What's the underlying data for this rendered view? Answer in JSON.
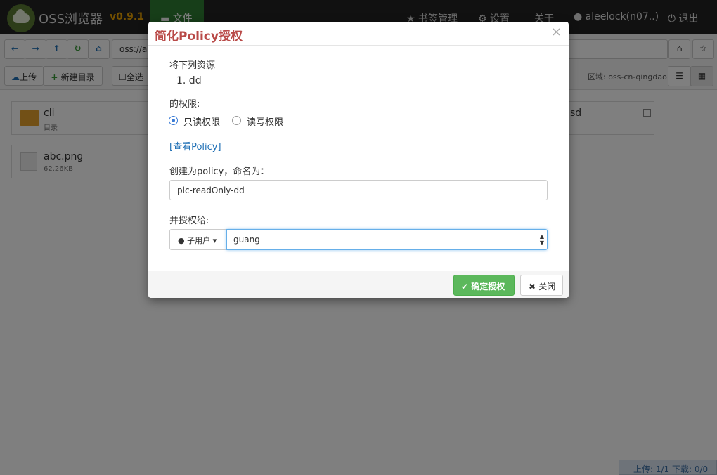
{
  "app": {
    "title": "OSS浏览器",
    "version": "v0.9.1"
  },
  "nav": {
    "file": "文件",
    "bookmarks": "书签管理",
    "settings": "设置",
    "about": "关于",
    "user": "aleelock(n07..)",
    "logout": "退出"
  },
  "address": {
    "value": "oss://a"
  },
  "toolbar": {
    "upload": "上传",
    "new_dir": "新建目录",
    "select_all": "全选"
  },
  "region": "区域: oss-cn-qingdao",
  "files": [
    {
      "name": "cli",
      "sub": "目录"
    },
    {
      "name": "abc.png",
      "sub": "62.26KB"
    },
    {
      "name": "sd"
    }
  ],
  "status": "上传: 1/1 下载: 0/0",
  "modal": {
    "title": "简化Policy授权",
    "close": "×",
    "resources_label": "将下列资源",
    "resource_item": "1. dd",
    "perm_label": "的权限:",
    "perm_readonly": "只读权限",
    "perm_readwrite": "读写权限",
    "view_policy": "[查看Policy]",
    "create_label": "创建为policy，命名为：",
    "policy_name": "plc-readOnly-dd",
    "grant_label": "并授权给:",
    "grant_type": "子用户",
    "grant_target": "guang",
    "ok": "确定授权",
    "cancel": "关闭"
  },
  "colors": {
    "accent_green": "#5cb85c",
    "title_red": "#b94a48",
    "link_blue": "#1e6fb5",
    "nav_active": "#2f7d32",
    "version_orange": "#e8a000"
  }
}
